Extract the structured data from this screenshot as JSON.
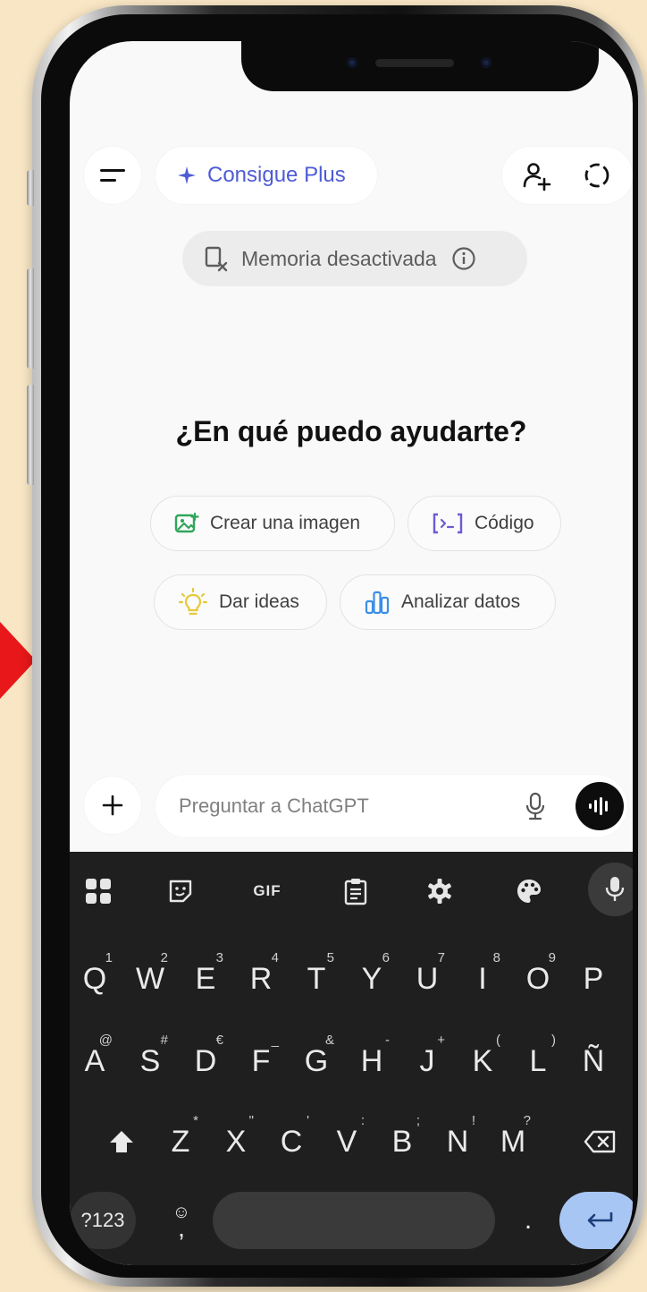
{
  "header": {
    "plus_label": "Consigue Plus"
  },
  "memory": {
    "label": "Memoria desactivada"
  },
  "main": {
    "headline": "¿En qué puedo ayudarte?",
    "chips": [
      {
        "label": "Crear una imagen",
        "icon": "image-create-icon",
        "color": "#2fa65a"
      },
      {
        "label": "Código",
        "icon": "code-icon",
        "color": "#6b5bd6"
      },
      {
        "label": "Dar ideas",
        "icon": "lightbulb-icon",
        "color": "#e5c93a"
      },
      {
        "label": "Analizar datos",
        "icon": "bar-chart-icon",
        "color": "#3a8ee6"
      }
    ]
  },
  "composer": {
    "placeholder": "Preguntar a ChatGPT"
  },
  "keyboard": {
    "toolbar": [
      "grid-icon",
      "sticker-icon",
      "GIF",
      "clipboard-icon",
      "gear-icon",
      "palette-icon",
      "mic-icon"
    ],
    "gif_label": "GIF",
    "row1": [
      {
        "k": "Q",
        "s": "1"
      },
      {
        "k": "W",
        "s": "2"
      },
      {
        "k": "E",
        "s": "3"
      },
      {
        "k": "R",
        "s": "4"
      },
      {
        "k": "T",
        "s": "5"
      },
      {
        "k": "Y",
        "s": "6"
      },
      {
        "k": "U",
        "s": "7"
      },
      {
        "k": "I",
        "s": "8"
      },
      {
        "k": "O",
        "s": "9"
      },
      {
        "k": "P",
        "s": ""
      }
    ],
    "row2": [
      {
        "k": "A",
        "s": "@"
      },
      {
        "k": "S",
        "s": "#"
      },
      {
        "k": "D",
        "s": "€"
      },
      {
        "k": "F",
        "s": "_"
      },
      {
        "k": "G",
        "s": "&"
      },
      {
        "k": "H",
        "s": "-"
      },
      {
        "k": "J",
        "s": "+"
      },
      {
        "k": "K",
        "s": "("
      },
      {
        "k": "L",
        "s": ")"
      },
      {
        "k": "Ñ",
        "s": ""
      }
    ],
    "row3": [
      {
        "k": "Z",
        "s": "*"
      },
      {
        "k": "X",
        "s": "\""
      },
      {
        "k": "C",
        "s": "'"
      },
      {
        "k": "V",
        "s": ":"
      },
      {
        "k": "B",
        "s": ";"
      },
      {
        "k": "N",
        "s": "!"
      },
      {
        "k": "M",
        "s": "?"
      }
    ],
    "numbers_label": "?123",
    "emoji_label": "☺",
    "comma_label": ",",
    "period_label": "."
  },
  "colors": {
    "background": "#f8e6c5",
    "accent": "#4e5bd6",
    "keyboard_bg": "#1f1f1f",
    "enter_key": "#a7c6f3",
    "arrow": "#e8181a"
  }
}
